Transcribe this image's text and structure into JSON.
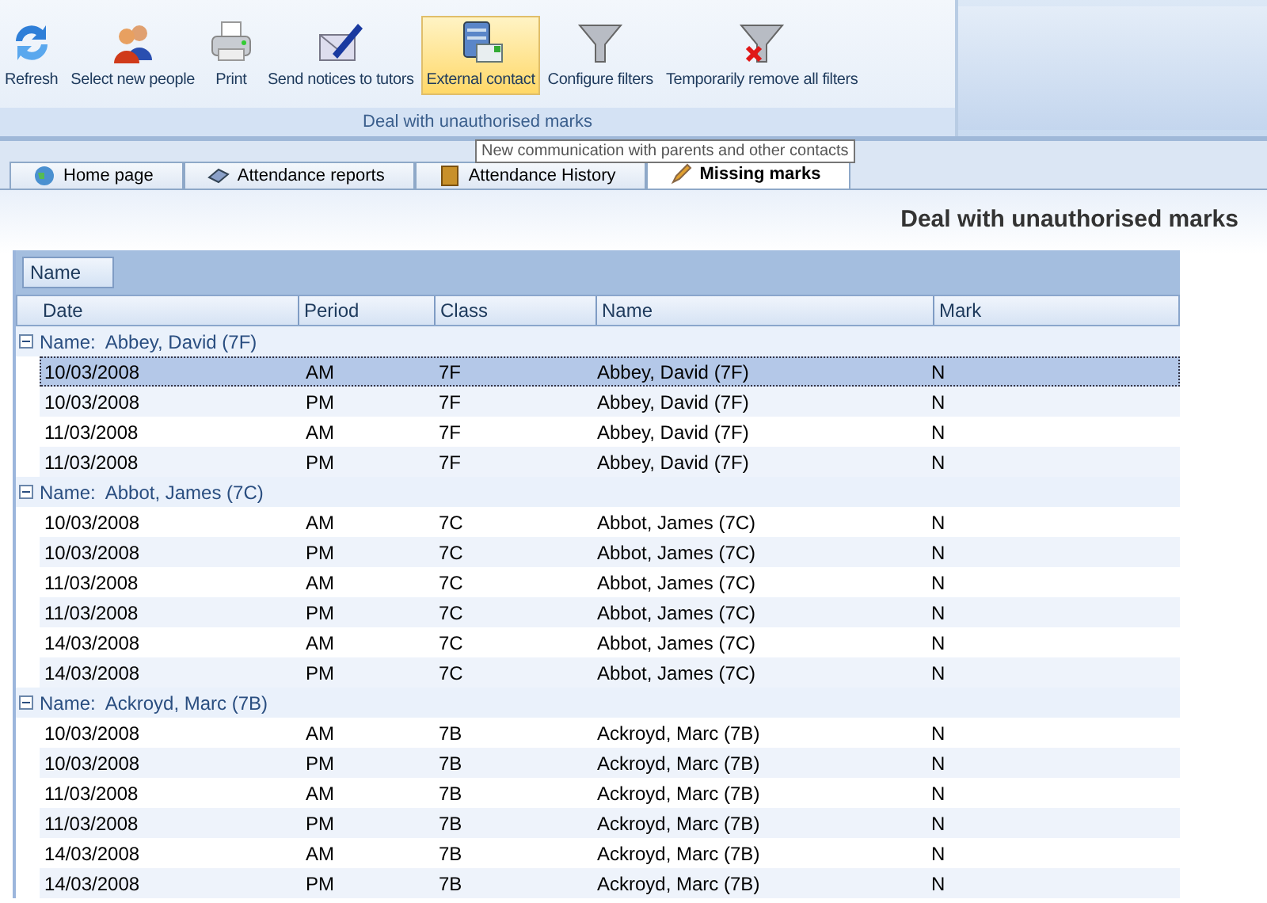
{
  "ribbon": {
    "buttons": [
      {
        "label": "Refresh",
        "selected": false
      },
      {
        "label": "Select new people",
        "selected": false
      },
      {
        "label": "Print",
        "selected": false
      },
      {
        "label": "Send notices to tutors",
        "selected": false
      },
      {
        "label": "External contact",
        "selected": true
      },
      {
        "label": "Configure filters",
        "selected": false
      },
      {
        "label": "Temporarily remove all filters",
        "selected": false
      }
    ],
    "group_label": "Deal with unauthorised marks"
  },
  "tooltip": "New communication with parents and other contacts",
  "tabs": [
    {
      "label": "Home page",
      "selected": false
    },
    {
      "label": "Attendance reports",
      "selected": false
    },
    {
      "label": "Attendance History",
      "selected": false
    },
    {
      "label": "Missing marks",
      "selected": true
    }
  ],
  "page_title": "Deal with unauthorised marks",
  "grid": {
    "group_by": "Name",
    "columns": [
      "Date",
      "Period",
      "Class",
      "Name",
      "Mark"
    ],
    "groups": [
      {
        "label": "Name:  Abbey, David (7F)",
        "expanded": true,
        "rows": [
          {
            "cells": [
              "10/03/2008",
              "AM",
              "7F",
              "Abbey, David (7F)",
              "N"
            ],
            "selected": true
          },
          {
            "cells": [
              "10/03/2008",
              "PM",
              "7F",
              "Abbey, David (7F)",
              "N"
            ],
            "selected": false
          },
          {
            "cells": [
              "11/03/2008",
              "AM",
              "7F",
              "Abbey, David (7F)",
              "N"
            ],
            "selected": false
          },
          {
            "cells": [
              "11/03/2008",
              "PM",
              "7F",
              "Abbey, David (7F)",
              "N"
            ],
            "selected": false
          }
        ]
      },
      {
        "label": "Name:  Abbot, James (7C)",
        "expanded": true,
        "rows": [
          {
            "cells": [
              "10/03/2008",
              "AM",
              "7C",
              "Abbot, James (7C)",
              "N"
            ],
            "selected": false
          },
          {
            "cells": [
              "10/03/2008",
              "PM",
              "7C",
              "Abbot, James (7C)",
              "N"
            ],
            "selected": false
          },
          {
            "cells": [
              "11/03/2008",
              "AM",
              "7C",
              "Abbot, James (7C)",
              "N"
            ],
            "selected": false
          },
          {
            "cells": [
              "11/03/2008",
              "PM",
              "7C",
              "Abbot, James (7C)",
              "N"
            ],
            "selected": false
          },
          {
            "cells": [
              "14/03/2008",
              "AM",
              "7C",
              "Abbot, James (7C)",
              "N"
            ],
            "selected": false
          },
          {
            "cells": [
              "14/03/2008",
              "PM",
              "7C",
              "Abbot, James (7C)",
              "N"
            ],
            "selected": false
          }
        ]
      },
      {
        "label": "Name:  Ackroyd, Marc (7B)",
        "expanded": true,
        "rows": [
          {
            "cells": [
              "10/03/2008",
              "AM",
              "7B",
              "Ackroyd, Marc (7B)",
              "N"
            ],
            "selected": false
          },
          {
            "cells": [
              "10/03/2008",
              "PM",
              "7B",
              "Ackroyd, Marc (7B)",
              "N"
            ],
            "selected": false
          },
          {
            "cells": [
              "11/03/2008",
              "AM",
              "7B",
              "Ackroyd, Marc (7B)",
              "N"
            ],
            "selected": false
          },
          {
            "cells": [
              "11/03/2008",
              "PM",
              "7B",
              "Ackroyd, Marc (7B)",
              "N"
            ],
            "selected": false
          },
          {
            "cells": [
              "14/03/2008",
              "AM",
              "7B",
              "Ackroyd, Marc (7B)",
              "N"
            ],
            "selected": false
          },
          {
            "cells": [
              "14/03/2008",
              "PM",
              "7B",
              "Ackroyd, Marc (7B)",
              "N"
            ],
            "selected": false
          }
        ]
      }
    ]
  }
}
